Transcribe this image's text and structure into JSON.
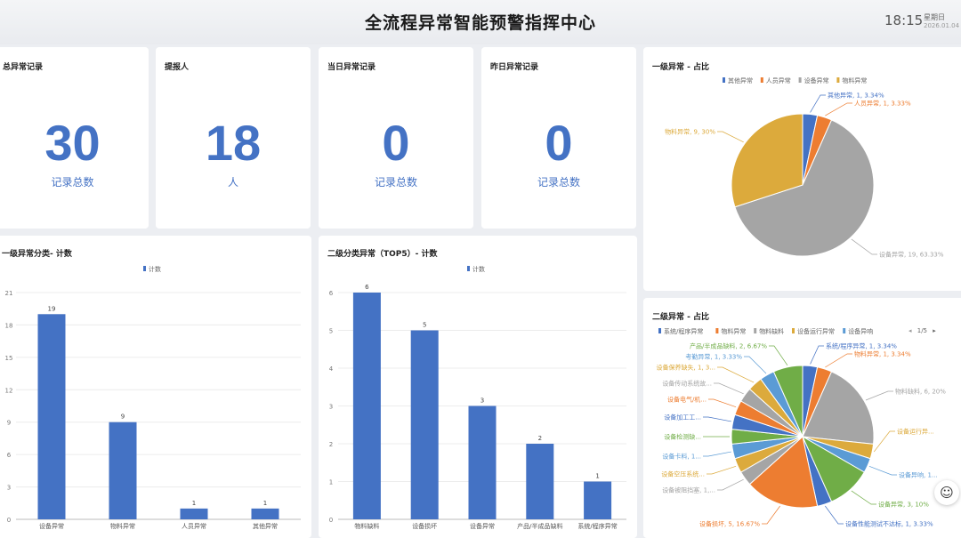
{
  "header": {
    "title": "全流程异常智能预警指挥中心",
    "time": "18:15",
    "weekday": "星期日",
    "date": "2026.01.04"
  },
  "stats": [
    {
      "title": "总异常记录",
      "value": "30",
      "unit": "记录总数"
    },
    {
      "title": "提报人",
      "value": "18",
      "unit": "人"
    },
    {
      "title": "当日异常记录",
      "value": "0",
      "unit": "记录总数"
    },
    {
      "title": "昨日异常记录",
      "value": "0",
      "unit": "记录总数"
    }
  ],
  "colors": {
    "accent": "#4472c4",
    "orange": "#ed7d31",
    "gray": "#a5a5a5",
    "gold": "#dcaa3c",
    "blue2": "#5b9bd5",
    "green": "#70ad47"
  },
  "pager": {
    "prev": "◂",
    "text": "1/5",
    "next": "▸"
  },
  "help": {
    "icon": "customer-service-icon",
    "glyph": "☺"
  },
  "chart_data": [
    {
      "type": "bar",
      "title": "一级异常分类- 计数",
      "legend": [
        "计数"
      ],
      "categories": [
        "设备异常",
        "物料异常",
        "人员异常",
        "其他异常"
      ],
      "series": [
        {
          "name": "计数",
          "values": [
            19,
            9,
            1,
            1
          ]
        }
      ],
      "ylim": [
        0,
        21
      ],
      "yticks": [
        "0",
        "3",
        "6",
        "9",
        "12",
        "15",
        "18",
        "21"
      ],
      "data_labels": [
        "19",
        "9",
        "1",
        "1"
      ],
      "grid": true
    },
    {
      "type": "bar",
      "title": "二级分类异常（TOP5）- 计数",
      "legend": [
        "计数"
      ],
      "categories": [
        "物料缺料",
        "设备损坏",
        "设备异常",
        "产品/半成品缺料",
        "系统/程序异常"
      ],
      "series": [
        {
          "name": "计数",
          "values": [
            6,
            5,
            3,
            2,
            1
          ]
        }
      ],
      "ylim": [
        0,
        6
      ],
      "yticks": [
        "0",
        "1",
        "2",
        "3",
        "4",
        "5",
        "6"
      ],
      "data_labels": [
        "6",
        "5",
        "3",
        "2",
        "1"
      ],
      "grid": true
    },
    {
      "type": "pie",
      "title": "一级异常 - 占比",
      "legend": [
        "其他异常",
        "人员异常",
        "设备异常",
        "物料异常"
      ],
      "slices": [
        {
          "name": "其他异常",
          "value": 1,
          "color": "#4472c4",
          "label": "其他异常, 1, 3.34%"
        },
        {
          "name": "人员异常",
          "value": 1,
          "color": "#ed7d31",
          "label": "人员异常, 1, 3.33%"
        },
        {
          "name": "设备异常",
          "value": 19,
          "color": "#a5a5a5",
          "label": "设备异常, 19, 63.33%"
        },
        {
          "name": "物料异常",
          "value": 9,
          "color": "#dcaa3c",
          "label": "物料异常, 9, 30%"
        }
      ]
    },
    {
      "type": "pie",
      "title": "二级异常 - 占比",
      "legend": [
        "系统/程序异常",
        "物料异常",
        "物料缺料",
        "设备运行异常",
        "设备异响"
      ],
      "slices": [
        {
          "name": "系统/程序异常",
          "value": 1,
          "color": "#4472c4",
          "label": "系统/程序异常, 1, 3.34%"
        },
        {
          "name": "物料异常",
          "value": 1,
          "color": "#ed7d31",
          "label": "物料异常, 1, 3.34%"
        },
        {
          "name": "物料缺料",
          "value": 6,
          "color": "#a5a5a5",
          "label": "物料缺料, 6, 20%"
        },
        {
          "name": "设备运行异常",
          "value": 1,
          "color": "#dcaa3c",
          "label": "设备运行异..."
        },
        {
          "name": "设备异响",
          "value": 1,
          "color": "#5b9bd5",
          "label": "设备异响, 1..."
        },
        {
          "name": "设备异常",
          "value": 3,
          "color": "#70ad47",
          "label": "设备异常, 3, 10%"
        },
        {
          "name": "设备性能测试不达标",
          "value": 1,
          "color": "#4472c4",
          "label": "设备性能测试不达标, 1, 3.33%"
        },
        {
          "name": "设备损坏",
          "value": 5,
          "color": "#ed7d31",
          "label": "设备损坏, 5, 16.67%"
        },
        {
          "name": "设备被阻挡",
          "value": 1,
          "color": "#a5a5a5",
          "label": "设备被阻挡塞, 1,..."
        },
        {
          "name": "设备空压系统",
          "value": 1,
          "color": "#dcaa3c",
          "label": "设备空压系统..."
        },
        {
          "name": "设备卡料",
          "value": 1,
          "color": "#5b9bd5",
          "label": "设备卡料, 1..."
        },
        {
          "name": "设备检测缺",
          "value": 1,
          "color": "#70ad47",
          "label": "设备检测缺..."
        },
        {
          "name": "设备加工",
          "value": 1,
          "color": "#4472c4",
          "label": "设备加工工..."
        },
        {
          "name": "设备电气/机",
          "value": 1,
          "color": "#ed7d31",
          "label": "设备电气/机..."
        },
        {
          "name": "设备传动系统",
          "value": 1,
          "color": "#a5a5a5",
          "label": "设备传动系统故..."
        },
        {
          "name": "设备保养缺失",
          "value": 1,
          "color": "#dcaa3c",
          "label": "设备保养缺失, 1, 3..."
        },
        {
          "name": "考勤异常",
          "value": 1,
          "color": "#5b9bd5",
          "label": "考勤异常, 1, 3.33%"
        },
        {
          "name": "产品/半成品缺料",
          "value": 2,
          "color": "#70ad47",
          "label": "产品/半成品缺料, 2, 6.67%"
        }
      ]
    }
  ]
}
